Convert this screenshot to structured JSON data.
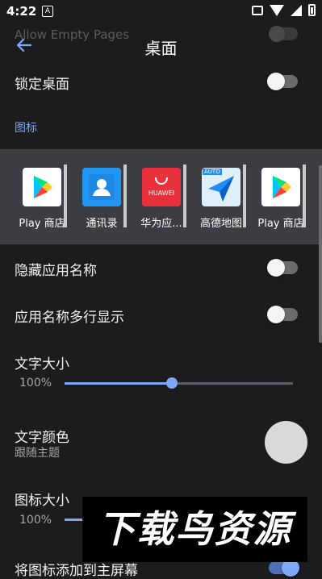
{
  "status_bar": {
    "time": "4:22",
    "sim_badge": "A",
    "icons": [
      "vibrate-icon",
      "wifi-icon",
      "cell-signal-icon",
      "battery-icon"
    ]
  },
  "header": {
    "title": "桌面",
    "back_icon": "arrow-left-icon",
    "scrolled_ghost_label": "Allow Empty Pages"
  },
  "settings": {
    "lock_desktop": {
      "label": "锁定桌面",
      "on": false
    },
    "icons_section": "图标",
    "hide_app_name": {
      "label": "隐藏应用名称",
      "on": false
    },
    "multiline_app_name": {
      "label": "应用名称多行显示",
      "on": false
    },
    "text_size": {
      "label": "文字大小",
      "value_text": "100%",
      "fraction": 0.47
    },
    "text_color": {
      "label": "文字颜色",
      "sub": "跟随主题",
      "swatch": "#d9d9d9"
    },
    "icon_size": {
      "label": "图标大小",
      "value_text": "100%"
    },
    "add_to_home": {
      "label": "将图标添加到主屏幕",
      "on": true
    }
  },
  "preview_apps": [
    {
      "label": "Play 商店",
      "icon": "play-store-icon"
    },
    {
      "label": "通讯录",
      "icon": "contacts-icon"
    },
    {
      "label": "华为应...",
      "icon": "huawei-appgallery-icon",
      "icon_text": "HUAWEI"
    },
    {
      "label": "高德地图",
      "icon": "amap-icon",
      "icon_text": "AUTO"
    },
    {
      "label": "Play 商店",
      "icon": "play-store-icon"
    }
  ],
  "watermark": {
    "text": "下载鸟资源"
  },
  "colors": {
    "accent": "#7ea7f5",
    "background": "#1c1c1e",
    "preview_bg": "#3b3d42"
  }
}
